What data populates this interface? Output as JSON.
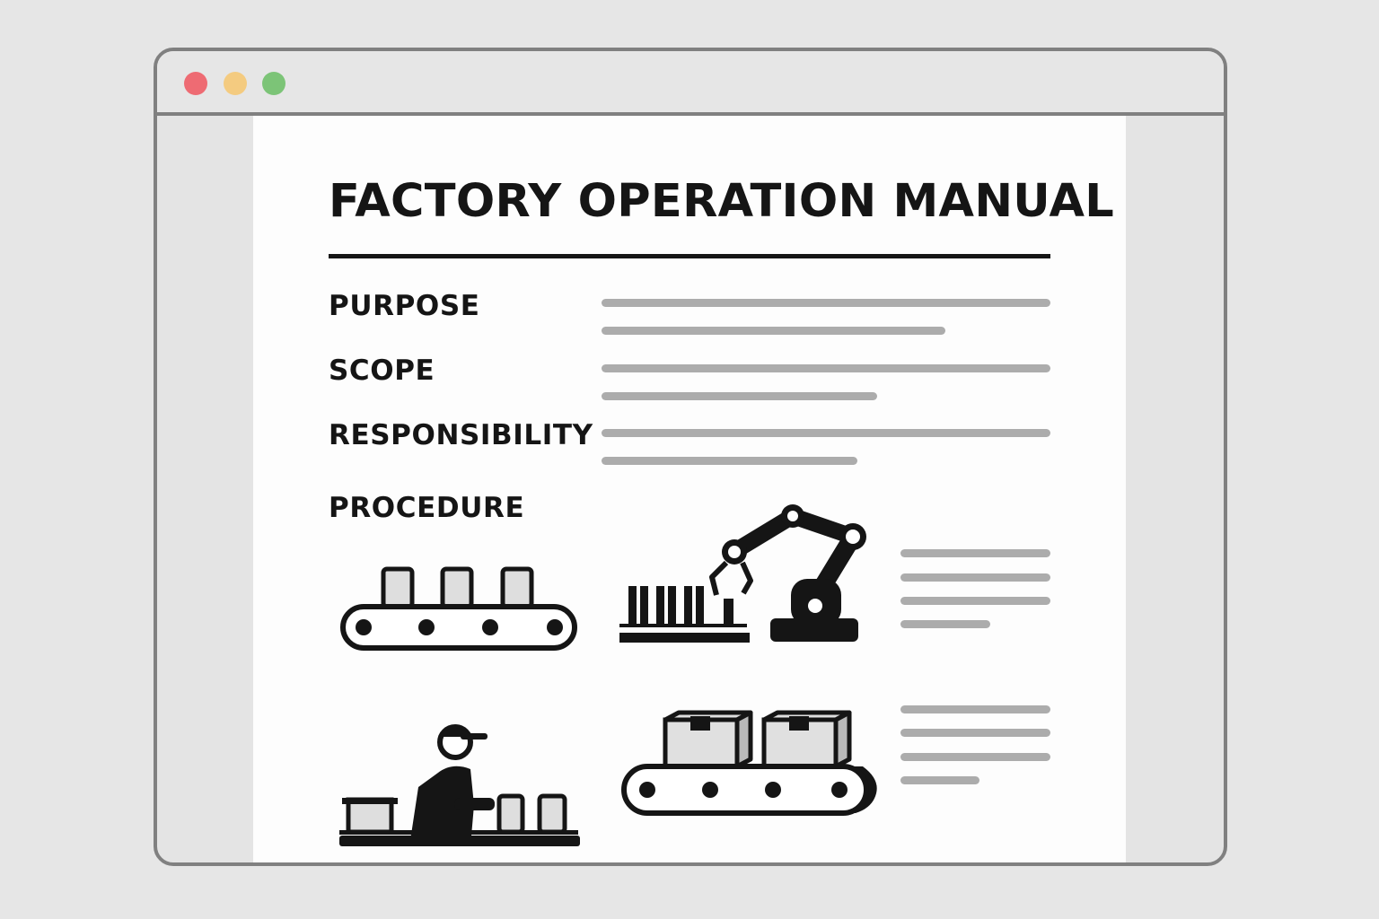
{
  "window": {
    "controls": [
      {
        "name": "close",
        "color": "#ee6b73"
      },
      {
        "name": "minimize",
        "color": "#f4cb80"
      },
      {
        "name": "maximize",
        "color": "#7cc477"
      }
    ]
  },
  "document": {
    "title": "FACTORY OPERATION MANUAL",
    "sections": [
      {
        "label": "PURPOSE"
      },
      {
        "label": "SCOPE"
      },
      {
        "label": "RESPONSIBILITY"
      },
      {
        "label": "PROCEDURE"
      }
    ],
    "illustrations": [
      {
        "icon": "conveyor-belt-containers-icon"
      },
      {
        "icon": "robotic-arm-icon"
      },
      {
        "icon": "worker-assembly-line-icon"
      },
      {
        "icon": "conveyor-belt-boxes-icon"
      }
    ]
  },
  "colors": {
    "text": "#151515",
    "placeholder_line": "#acacac",
    "frame": "#808080",
    "page": "#fdfdfd",
    "background": "#e6e6e6"
  }
}
